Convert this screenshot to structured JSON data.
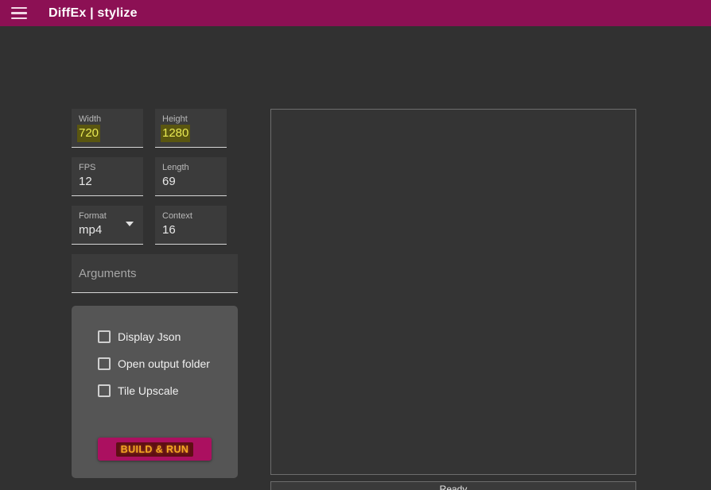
{
  "titlebar": {
    "menu_icon": "hamburger-icon",
    "title": "DiffEx | stylize",
    "bg_color": "#8C1054"
  },
  "form": {
    "rows": [
      [
        {
          "label": "Width",
          "value": "720",
          "highlighted": true,
          "type": "text"
        },
        {
          "label": "Height",
          "value": "1280",
          "highlighted": true,
          "type": "text"
        }
      ],
      [
        {
          "label": "FPS",
          "value": "12",
          "highlighted": false,
          "type": "text"
        },
        {
          "label": "Length",
          "value": "69",
          "highlighted": false,
          "type": "text"
        }
      ],
      [
        {
          "label": "Format",
          "value": "mp4",
          "highlighted": false,
          "type": "select"
        },
        {
          "label": "Context",
          "value": "16",
          "highlighted": false,
          "type": "text"
        }
      ]
    ],
    "arguments_placeholder": "Arguments",
    "arguments_value": "",
    "highlight_bg": "#5a5610",
    "highlight_fg": "#e9ea52"
  },
  "options": {
    "checkboxes": [
      {
        "label": "Display Json",
        "checked": false
      },
      {
        "label": "Open output folder",
        "checked": false
      },
      {
        "label": "Tile Upscale",
        "checked": false
      }
    ],
    "build_button_label": "BUILD & RUN",
    "build_button_bg": "#AB1060",
    "build_button_fg": "#f5a623"
  },
  "preview": {
    "content": ""
  },
  "status": {
    "text": "Ready"
  }
}
